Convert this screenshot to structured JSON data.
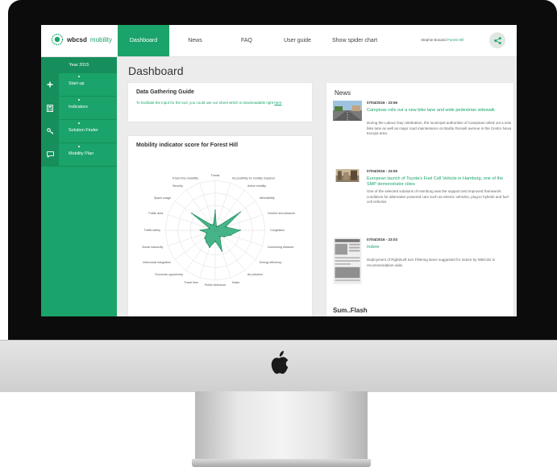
{
  "nav": {
    "brand": {
      "name": "wbcsd",
      "product": "mobility"
    },
    "items": [
      {
        "label": "Dashboard",
        "active": true
      },
      {
        "label": "News"
      },
      {
        "label": "FAQ"
      },
      {
        "label": "User guide"
      },
      {
        "label": "Show spider chart"
      }
    ],
    "user": {
      "name": "Stephie Bosand",
      "location": "Forest Hill"
    },
    "share_icon": "share-icon"
  },
  "sidebar": {
    "year": "Year 2015",
    "items": [
      {
        "label": "Start-up",
        "icon": "plus-icon"
      },
      {
        "label": "Indicators",
        "icon": "calculator-icon"
      },
      {
        "label": "Solution Finder",
        "icon": "key-icon"
      },
      {
        "label": "Mobility Plan",
        "icon": "chat-icon"
      }
    ]
  },
  "main": {
    "title": "Dashboard",
    "guide": {
      "title": "Data Gathering Guide",
      "text": "To facilitate the input for the tool, you could use our sheet which is downloadable right",
      "link": "here"
    },
    "chart_card": {
      "title": "Mobility indicator score for Forest Hill"
    },
    "news": {
      "title": "News",
      "items": [
        {
          "date": "07/04/2016 - 23:56",
          "headline": "Campinas rolls out a new bike lane and wide pedestrian sidewalk",
          "body": "During the Labour Day celebration, the municipal authorities of Campinas rolled out a new bike lane as well as major road maintenance on Barão Rossell avenue in the Centro Nova Europa area.",
          "thumb": "road-photo"
        },
        {
          "date": "07/04/2016 - 23:05",
          "headline": "European launch of Toyota's Fuel Cell Vehicle in Hamburg, one of the SMP demonstrator cities",
          "body": "One of the selected solutions of Hamburg was the support and improved framework conditions for alternative powered cars such as electric vehicles, plug-in hybrids and fuel cell vehicles.",
          "thumb": "city-photo"
        },
        {
          "date": "07/04/2016 - 23:03",
          "headline": "Indore",
          "body": "Deployment of Right/Left turn Filtering lanes suggested for Indore by WBCSD is recommendation wide.",
          "thumb": "newspaper-photo"
        }
      ],
      "more_heading": "Sum..Flash"
    }
  },
  "chart_data": {
    "type": "radar",
    "title": "Mobility indicator score for Forest Hill",
    "categories": [
      "Transit",
      "Accessibility for mobility impaired",
      "Active mobility",
      "Affordability",
      "Comfort and pleasure",
      "Congestion",
      "Commuting distance",
      "Energy efficiency",
      "Air pollution",
      "Noise",
      "Public hindrance",
      "Travel time",
      "Economic opportunity",
      "Intermodal integration",
      "Social inclusivity",
      "Traffic safety",
      "Public area",
      "Space usage",
      "Security",
      "Travel time reliability"
    ],
    "values": [
      40,
      8,
      10,
      62,
      22,
      50,
      32,
      22,
      16,
      44,
      22,
      36,
      30,
      26,
      18,
      30,
      12,
      58,
      14,
      12
    ],
    "max": 100,
    "fill_color": "#1aa36a",
    "grid": true
  },
  "colors": {
    "accent": "#1aa36a",
    "accent_dark": "#168f5c"
  }
}
